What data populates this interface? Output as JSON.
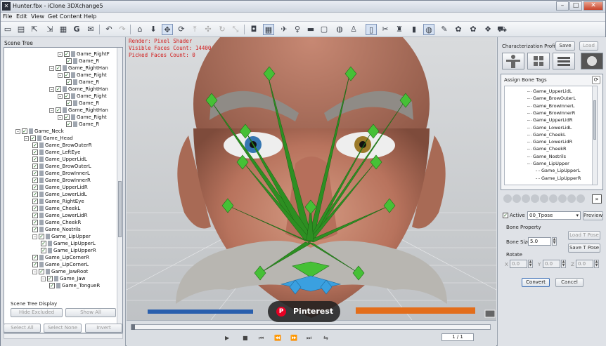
{
  "window": {
    "title": "Hunter.fbx - iClone 3DXchange5",
    "app_icon": "iclone-icon"
  },
  "menu": [
    "File",
    "Edit",
    "View",
    "Get Content",
    "Help"
  ],
  "toolbar_icons": [
    "open-icon",
    "save-icon",
    "export-icon",
    "import-icon",
    "export-fbx-icon",
    "get-content-icon",
    "help-icon",
    "undo-icon",
    "redo-icon",
    "home-icon",
    "down-arrow-icon",
    "move-icon",
    "rotate-icon",
    "move-up-icon",
    "move-right-icon",
    "refresh-icon",
    "resize-icon",
    "select-icon",
    "grid-icon",
    "camera-icon",
    "light-icon",
    "screen-icon",
    "wireframe-icon",
    "sphere-icon",
    "figure-icon",
    "character-icon",
    "bone-icon",
    "globe-icon",
    "wrench-icon",
    "paint-icon",
    "morph-icon",
    "fill-icon",
    "cart-icon"
  ],
  "left_panel": {
    "title": "Scene Tree",
    "tree": [
      {
        "label": "Game_RightF",
        "checked": true,
        "level": 6
      },
      {
        "label": "Game_R",
        "checked": true,
        "level": 7
      },
      {
        "label": "Game_RightHan",
        "checked": true,
        "level": 5
      },
      {
        "label": "Game_Right",
        "checked": true,
        "level": 6
      },
      {
        "label": "Game_R",
        "checked": true,
        "level": 7
      },
      {
        "label": "Game_RightHan",
        "checked": true,
        "level": 5
      },
      {
        "label": "Game_Right",
        "checked": true,
        "level": 6
      },
      {
        "label": "Game_R",
        "checked": true,
        "level": 7
      },
      {
        "label": "Game_RightHan",
        "checked": true,
        "level": 5
      },
      {
        "label": "Game_Right",
        "checked": true,
        "level": 6
      },
      {
        "label": "Game_R",
        "checked": true,
        "level": 7
      },
      {
        "label": "Game_Neck",
        "checked": true,
        "level": 1
      },
      {
        "label": "Game_Head",
        "checked": true,
        "level": 2
      },
      {
        "label": "Game_BrowOuterR",
        "checked": true,
        "level": 3
      },
      {
        "label": "Game_LeftEye",
        "checked": true,
        "level": 3
      },
      {
        "label": "Game_UpperLidL",
        "checked": true,
        "level": 3
      },
      {
        "label": "Game_BrowOuterL",
        "checked": true,
        "level": 3
      },
      {
        "label": "Game_BrowInnerL",
        "checked": true,
        "level": 3
      },
      {
        "label": "Game_BrowInnerR",
        "checked": true,
        "level": 3
      },
      {
        "label": "Game_UpperLidR",
        "checked": true,
        "level": 3
      },
      {
        "label": "Game_LowerLidL",
        "checked": true,
        "level": 3
      },
      {
        "label": "Game_RightEye",
        "checked": true,
        "level": 3
      },
      {
        "label": "Game_CheekL",
        "checked": true,
        "level": 3
      },
      {
        "label": "Game_LowerLidR",
        "checked": true,
        "level": 3
      },
      {
        "label": "Game_CheekR",
        "checked": true,
        "level": 3
      },
      {
        "label": "Game_Nostrils",
        "checked": true,
        "level": 3
      },
      {
        "label": "Game_LipUpper",
        "checked": true,
        "level": 3
      },
      {
        "label": "Game_LipUpperL",
        "checked": true,
        "level": 4
      },
      {
        "label": "Game_LipUpperR",
        "checked": true,
        "level": 4
      },
      {
        "label": "Game_LipCornerR",
        "checked": true,
        "level": 3
      },
      {
        "label": "Game_LipCornerL",
        "checked": true,
        "level": 3
      },
      {
        "label": "Game_JawRoot",
        "checked": true,
        "level": 3
      },
      {
        "label": "Game_Jaw",
        "checked": true,
        "level": 4
      },
      {
        "label": "Game_TongueR",
        "checked": true,
        "level": 5
      }
    ],
    "display_label": "Scene Tree Display",
    "hide_excluded": "Hide Excluded",
    "show_all": "Show All",
    "select_all": "Select All",
    "select_none": "Select None",
    "invert": "Invert"
  },
  "viewport": {
    "render": "Render: Pixel Shader",
    "visible_faces": "Visible Faces Count: 14400",
    "picked_faces": "Picked Faces Count: 0"
  },
  "timeline": {
    "frame": "1 / 1"
  },
  "right_panel": {
    "profile_label": "Characterization Profile",
    "save": "Save",
    "load": "Load",
    "assign_label": "Assign Bone Tags",
    "bones": [
      "Game_UpperLidL",
      "Game_BrowOuterL",
      "Game_BrowInnerL",
      "Game_BrowInnerR",
      "Game_UpperLidR",
      "Game_LowerLidL",
      "Game_CheekL",
      "Game_LowerLidR",
      "Game_CheekR",
      "Game_Nostrils",
      "Game_LipUpper",
      "Game_LipUpperL",
      "Game_LipUpperR"
    ],
    "active_label": "Active",
    "pose_value": "00_Tpose",
    "preview": "Preview",
    "bone_property": "Bone Property",
    "load_tpose": "Load T Pose",
    "bone_size_label": "Bone Size",
    "bone_size_value": "5.0",
    "save_tpose": "Save T Pose",
    "rotate_label": "Rotate",
    "x_label": "X",
    "y_label": "Y",
    "z_label": "Z",
    "x_value": "0.0",
    "y_value": "0.0",
    "z_value": "0.0",
    "convert": "Convert",
    "cancel": "Cancel"
  },
  "overlay": {
    "pinterest": "Pinterest"
  }
}
